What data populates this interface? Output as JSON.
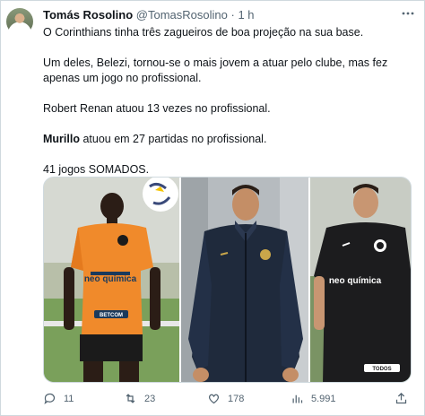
{
  "tweet": {
    "author_name": "Tomás Rosolino",
    "author_handle": "@TomasRosolino",
    "separator": "·",
    "time": "1 h",
    "more_icon": "more-icon",
    "paragraphs": [
      "O Corinthians tinha três zagueiros de boa projeção na sua base.",
      "Um deles, Belezi, tornou-se o mais jovem a atuar pelo clube, mas fez apenas um jogo no profissional.",
      "Robert Renan atuou 13 vezes no profissional."
    ],
    "murillo_bold": "Murillo",
    "murillo_rest": " atuou em 27 partidas no profissional.",
    "summary": "41 jogos SOMADOS."
  },
  "media": {
    "photos": [
      {
        "icon": "player-photo-orange-kit",
        "sponsor_text": "neo química",
        "sponsor_2": "BETCOM"
      },
      {
        "icon": "player-photo-rain-jacket"
      },
      {
        "icon": "player-photo-black-kit",
        "sponsor_text": "neo química",
        "sponsor_2": "TODOS"
      }
    ]
  },
  "actions": {
    "replies": "11",
    "retweets": "23",
    "likes": "178",
    "views": "5.991"
  },
  "colors": {
    "text": "#0f1419",
    "muted": "#536471",
    "border": "#cfd9de",
    "orange_kit": "#f08a2b",
    "navy_jacket": "#1f2a3c",
    "black_kit": "#1c1c1e"
  }
}
